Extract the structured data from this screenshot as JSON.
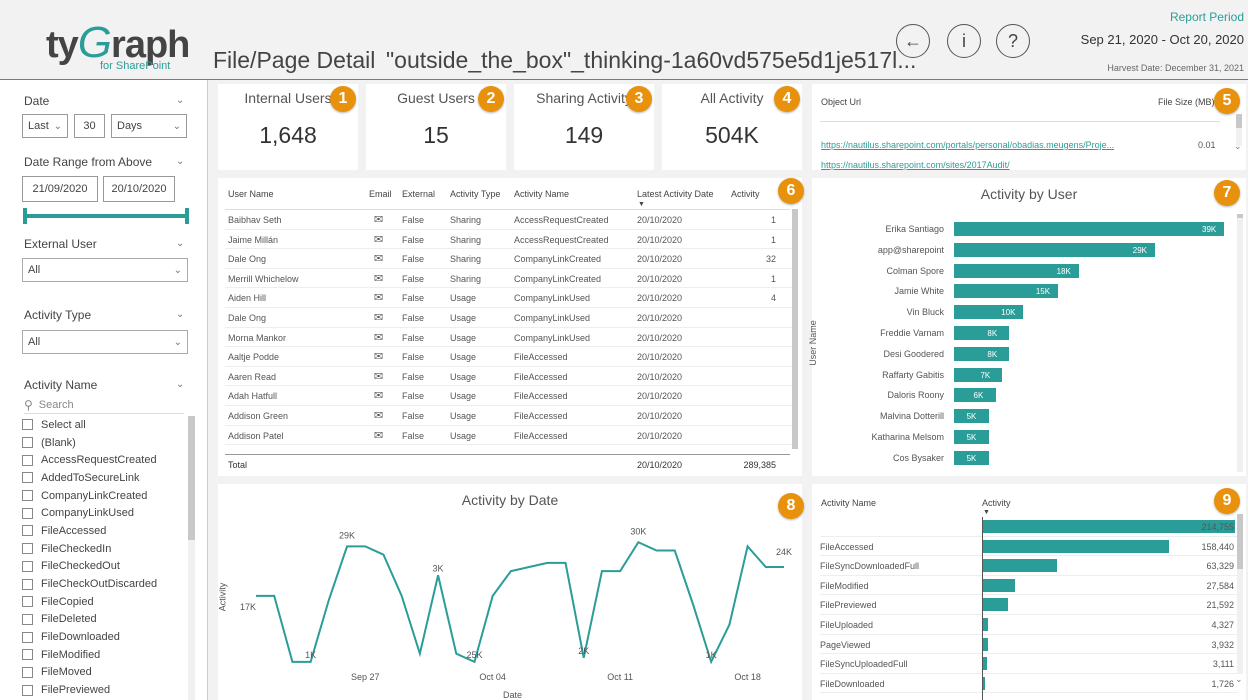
{
  "header": {
    "logo_prefix": "ty",
    "logo_g": "G",
    "logo_suffix": "raph",
    "logo_sub": "for SharePoint",
    "page_title": "File/Page Detail",
    "file_title": "\"outside_the_box\"_thinking-1a60vd575e5d1je517l...",
    "report_period_label": "Report Period",
    "report_period": "Sep 21, 2020 - Oct 20, 2020",
    "harvest_date": "Harvest Date: December 31, 2021",
    "back_icon": "←",
    "info_icon": "i",
    "help_icon": "?"
  },
  "sidebar": {
    "date_label": "Date",
    "date_unit_left": "Last",
    "date_number": "30",
    "date_unit": "Days",
    "range_label": "Date Range from Above",
    "range_start": "21/09/2020",
    "range_end": "20/10/2020",
    "external_user_label": "External User",
    "external_user_value": "All",
    "activity_type_label": "Activity Type",
    "activity_type_value": "All",
    "activity_name_label": "Activity Name",
    "search_placeholder": "Search",
    "activity_names": [
      "Select all",
      "(Blank)",
      "AccessRequestCreated",
      "AddedToSecureLink",
      "CompanyLinkCreated",
      "CompanyLinkUsed",
      "FileAccessed",
      "FileCheckedIn",
      "FileCheckedOut",
      "FileCheckOutDiscarded",
      "FileCopied",
      "FileDeleted",
      "FileDownloaded",
      "FileModified",
      "FileMoved",
      "FilePreviewed"
    ]
  },
  "kpis": [
    {
      "title": "Internal Users",
      "value": "1,648",
      "badge": "1"
    },
    {
      "title": "Guest Users",
      "value": "15",
      "badge": "2"
    },
    {
      "title": "Sharing Activity",
      "value": "149",
      "badge": "3"
    },
    {
      "title": "All Activity",
      "value": "504K",
      "badge": "4"
    }
  ],
  "object_panel": {
    "col_url": "Object Url",
    "col_size": "File Size (MB)",
    "badge": "5",
    "rows": [
      {
        "url": "https://nautilus.sharepoint.com/portals/personal/obadias.meugens/Proje...",
        "size": "0.01"
      },
      {
        "url": "https://nautilus.sharepoint.com/sites/2017Audit/",
        "size": ""
      }
    ]
  },
  "user_table": {
    "badge": "6",
    "headers": {
      "user": "User Name",
      "email": "Email",
      "external": "External",
      "type": "Activity Type",
      "name": "Activity Name",
      "date": "Latest Activity Date",
      "activity": "Activity"
    },
    "rows": [
      {
        "user": "Baibhav Seth",
        "external": "False",
        "type": "Sharing",
        "name": "AccessRequestCreated",
        "date": "20/10/2020",
        "activity": "1"
      },
      {
        "user": "Jaime Millán",
        "external": "False",
        "type": "Sharing",
        "name": "AccessRequestCreated",
        "date": "20/10/2020",
        "activity": "1"
      },
      {
        "user": "Dale Ong",
        "external": "False",
        "type": "Sharing",
        "name": "CompanyLinkCreated",
        "date": "20/10/2020",
        "activity": "32"
      },
      {
        "user": "Merrill Whichelow",
        "external": "False",
        "type": "Sharing",
        "name": "CompanyLinkCreated",
        "date": "20/10/2020",
        "activity": "1"
      },
      {
        "user": "Aiden Hill",
        "external": "False",
        "type": "Usage",
        "name": "CompanyLinkUsed",
        "date": "20/10/2020",
        "activity": "4"
      },
      {
        "user": "Dale Ong",
        "external": "False",
        "type": "Usage",
        "name": "CompanyLinkUsed",
        "date": "20/10/2020",
        "activity": ""
      },
      {
        "user": "Morna Mankor",
        "external": "False",
        "type": "Usage",
        "name": "CompanyLinkUsed",
        "date": "20/10/2020",
        "activity": ""
      },
      {
        "user": "Aaltje Podde",
        "external": "False",
        "type": "Usage",
        "name": "FileAccessed",
        "date": "20/10/2020",
        "activity": ""
      },
      {
        "user": "Aaren Read",
        "external": "False",
        "type": "Usage",
        "name": "FileAccessed",
        "date": "20/10/2020",
        "activity": ""
      },
      {
        "user": "Adah Hatfull",
        "external": "False",
        "type": "Usage",
        "name": "FileAccessed",
        "date": "20/10/2020",
        "activity": ""
      },
      {
        "user": "Addison Green",
        "external": "False",
        "type": "Usage",
        "name": "FileAccessed",
        "date": "20/10/2020",
        "activity": ""
      },
      {
        "user": "Addison Patel",
        "external": "False",
        "type": "Usage",
        "name": "FileAccessed",
        "date": "20/10/2020",
        "activity": ""
      }
    ],
    "total_label": "Total",
    "total_date": "20/10/2020",
    "total_value": "289,385"
  },
  "activity_by_user": {
    "title": "Activity by User",
    "ylabel": "User Name",
    "badge": "7",
    "users": [
      "Erika Santiago",
      "app@sharepoint",
      "Colman Spore",
      "Jamie White",
      "Vin Bluck",
      "Freddie Varnam",
      "Desi Goodered",
      "Raffarty Gabitis",
      "Daloris Roony",
      "Malvina Dotterill",
      "Katharina Melsom",
      "Cos Bysaker"
    ],
    "values": [
      39,
      29,
      18,
      15,
      10,
      8,
      8,
      7,
      6,
      5,
      5,
      5
    ],
    "labels": [
      "39K",
      "29K",
      "18K",
      "15K",
      "10K",
      "8K",
      "8K",
      "7K",
      "6K",
      "5K",
      "5K",
      "5K"
    ]
  },
  "activity_by_date": {
    "title": "Activity by Date",
    "xlabel": "Date",
    "ylabel": "Activity",
    "badge": "8",
    "x_ticks": [
      "Sep 27",
      "Oct 04",
      "Oct 11",
      "Oct 18"
    ],
    "point_labels": [
      "17K",
      "1K",
      "29K",
      "3K",
      "25K",
      "2K",
      "30K",
      "1K",
      "24K"
    ]
  },
  "activity_name_table": {
    "col_name": "Activity Name",
    "col_activity": "Activity",
    "badge": "9",
    "rows": [
      {
        "name": "",
        "value": "214,755",
        "frac": 1.0
      },
      {
        "name": "FileAccessed",
        "value": "158,440",
        "frac": 0.738
      },
      {
        "name": "FileSyncDownloadedFull",
        "value": "63,329",
        "frac": 0.295
      },
      {
        "name": "FileModified",
        "value": "27,584",
        "frac": 0.128
      },
      {
        "name": "FilePreviewed",
        "value": "21,592",
        "frac": 0.1
      },
      {
        "name": "FileUploaded",
        "value": "4,327",
        "frac": 0.02
      },
      {
        "name": "PageViewed",
        "value": "3,932",
        "frac": 0.018
      },
      {
        "name": "FileSyncUploadedFull",
        "value": "3,111",
        "frac": 0.0145
      },
      {
        "name": "FileDownloaded",
        "value": "1,726",
        "frac": 0.008
      }
    ]
  },
  "chart_data": [
    {
      "type": "bar",
      "title": "Activity by User",
      "ylabel": "User Name",
      "categories": [
        "Erika Santiago",
        "app@sharepoint",
        "Colman Spore",
        "Jamie White",
        "Vin Bluck",
        "Freddie Varnam",
        "Desi Goodered",
        "Raffarty Gabitis",
        "Daloris Roony",
        "Malvina Dotterill",
        "Katharina Melsom",
        "Cos Bysaker"
      ],
      "values": [
        39000,
        29000,
        18000,
        15000,
        10000,
        8000,
        8000,
        7000,
        6000,
        5000,
        5000,
        5000
      ]
    },
    {
      "type": "line",
      "title": "Activity by Date",
      "xlabel": "Date",
      "ylabel": "Activity",
      "x": [
        "Sep 21",
        "Sep 22",
        "Sep 23",
        "Sep 24",
        "Sep 25",
        "Sep 26",
        "Sep 27",
        "Sep 28",
        "Sep 29",
        "Sep 30",
        "Oct 01",
        "Oct 02",
        "Oct 03",
        "Oct 04",
        "Oct 05",
        "Oct 06",
        "Oct 07",
        "Oct 08",
        "Oct 09",
        "Oct 10",
        "Oct 11",
        "Oct 12",
        "Oct 13",
        "Oct 14",
        "Oct 15",
        "Oct 16",
        "Oct 17",
        "Oct 18",
        "Oct 19",
        "Oct 20"
      ],
      "values": [
        17000,
        17000,
        1000,
        1000,
        16000,
        29000,
        29000,
        27000,
        17000,
        3000,
        22000,
        3000,
        1000,
        17000,
        23000,
        24000,
        25000,
        25000,
        2000,
        23000,
        23000,
        30000,
        28000,
        28000,
        15000,
        1000,
        10000,
        29000,
        24000,
        24000
      ],
      "x_ticks": [
        "Sep 27",
        "Oct 04",
        "Oct 11",
        "Oct 18"
      ]
    }
  ]
}
